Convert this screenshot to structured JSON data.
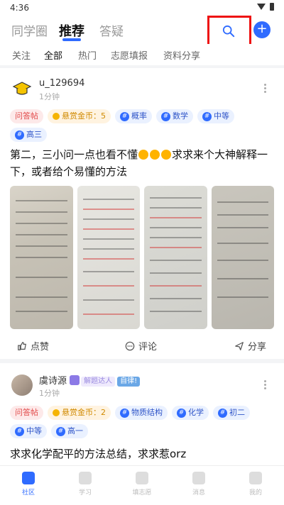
{
  "status": {
    "time": "4:36"
  },
  "top_tabs": [
    "同学圈",
    "推荐",
    "答疑"
  ],
  "sub_tabs": [
    "关注",
    "全部",
    "热门",
    "志愿填报",
    "资料分享"
  ],
  "posts": [
    {
      "username": "u_129694",
      "time_ago": "1分钟",
      "tags": {
        "type": "问答帖",
        "reward": "悬赏金币：5",
        "t1": "概率",
        "t2": "数学",
        "t3": "中等",
        "t4": "高三"
      },
      "text_a": "第二，三小问一点也看不懂",
      "text_b": "求求来个大神解释一下，或者给个易懂的方法",
      "image_count": 4
    },
    {
      "username": "虞诗源",
      "badge_text": "解题达人",
      "badge_self": "自律!",
      "time_ago": "1分钟",
      "tags": {
        "type": "问答帖",
        "reward": "悬赏金币：2",
        "t1": "物质结构",
        "t2": "化学",
        "t3": "初二",
        "t4": "中等",
        "t5": "高一"
      },
      "text_a": "求求化学配平的方法总结，求求惹orz"
    }
  ],
  "actions": {
    "like": "点赞",
    "comment": "评论",
    "share": "分享"
  },
  "bottom_nav": [
    "社区",
    "学习",
    "填志愿",
    "消息",
    "我的"
  ],
  "accent_color": "#2f6bff",
  "icons": [
    "search-icon",
    "plus-icon",
    "more-icon",
    "thumbs-up-icon",
    "comment-icon",
    "share-icon",
    "graduation-cap-icon"
  ]
}
